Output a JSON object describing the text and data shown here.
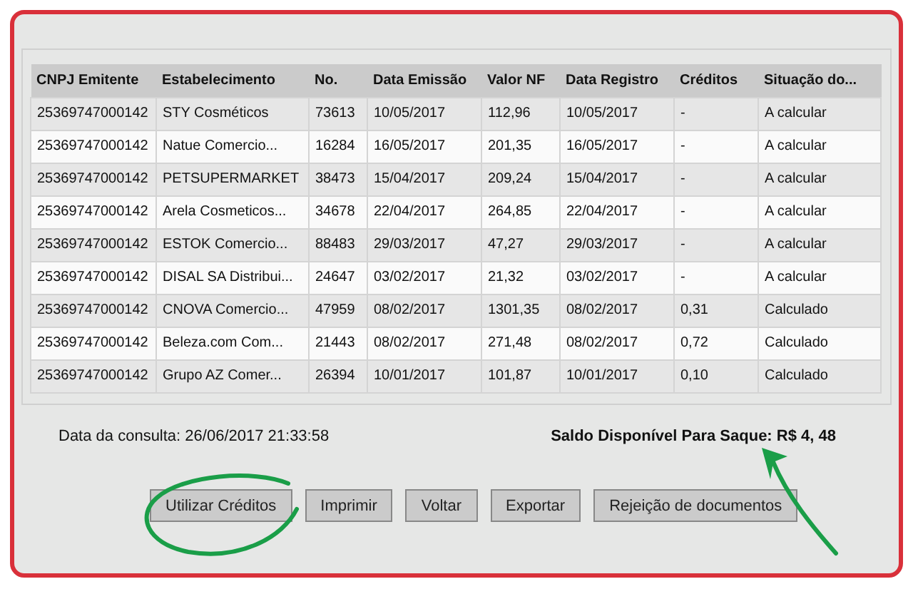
{
  "table": {
    "columns": [
      "CNPJ Emitente",
      "Estabelecimento",
      "No.",
      "Data Emissão",
      "Valor NF",
      "Data Registro",
      "Créditos",
      "Situação do..."
    ],
    "rows": [
      [
        "25369747000142",
        "STY Cosméticos",
        "73613",
        "10/05/2017",
        "112,96",
        "10/05/2017",
        "-",
        "A calcular"
      ],
      [
        "25369747000142",
        "Natue Comercio...",
        "16284",
        "16/05/2017",
        "201,35",
        "16/05/2017",
        "-",
        "A calcular"
      ],
      [
        "25369747000142",
        "PETSUPERMARKET",
        "38473",
        "15/04/2017",
        "209,24",
        "15/04/2017",
        "-",
        "A calcular"
      ],
      [
        "25369747000142",
        "Arela Cosmeticos...",
        "34678",
        "22/04/2017",
        "264,85",
        "22/04/2017",
        "-",
        "A calcular"
      ],
      [
        "25369747000142",
        "ESTOK Comercio...",
        "88483",
        "29/03/2017",
        "47,27",
        "29/03/2017",
        "-",
        "A calcular"
      ],
      [
        "25369747000142",
        "DISAL SA Distribui...",
        "24647",
        "03/02/2017",
        "21,32",
        "03/02/2017",
        "-",
        "A calcular"
      ],
      [
        "25369747000142",
        "CNOVA Comercio...",
        "47959",
        "08/02/2017",
        "1301,35",
        "08/02/2017",
        "0,31",
        "Calculado"
      ],
      [
        "25369747000142",
        "Beleza.com Com...",
        "21443",
        "08/02/2017",
        "271,48",
        "08/02/2017",
        "0,72",
        "Calculado"
      ],
      [
        "25369747000142",
        "Grupo AZ Comer...",
        "26394",
        "10/01/2017",
        "101,87",
        "10/01/2017",
        "0,10",
        "Calculado"
      ]
    ]
  },
  "query_date": "Data da consulta: 26/06/2017 21:33:58",
  "balance": "Saldo Disponível Para Saque: R$ 4, 48",
  "buttons": [
    "Utilizar Créditos",
    "Imprimir",
    "Voltar",
    "Exportar",
    "Rejeição de documentos"
  ]
}
